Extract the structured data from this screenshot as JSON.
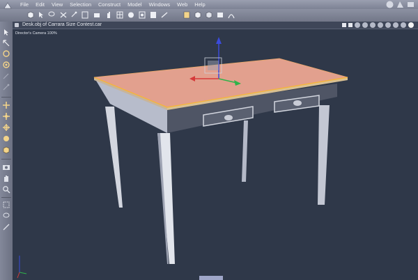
{
  "menu": [
    "File",
    "Edit",
    "View",
    "Selection",
    "Construct",
    "Model",
    "Windows",
    "Web",
    "Help"
  ],
  "viewport": {
    "title": "Desk.obj of Carrara Size Contest.car",
    "camera_label": "Director's Camera 100%"
  },
  "icons": {
    "toolbar": [
      "cube-icon",
      "arrow-icon",
      "lasso-icon",
      "scissors-icon",
      "rotate-icon",
      "cube-outline-icon",
      "camera-icon",
      "hand-icon",
      "grid-icon",
      "render-icon",
      "light-icon",
      "pen-icon",
      "box-icon",
      "box-icon-2",
      "morph-icon",
      "shader-icon"
    ],
    "leftbar": [
      "select-arrow-icon",
      "move-icon",
      "rotate-icon",
      "scale-icon",
      "pen-tool-icon",
      "magic-wand-icon",
      "move-planar-icon",
      "move-3d-icon",
      "rotate-3d-icon",
      "scale-3d-icon",
      "box-tool-icon",
      "camera-icon",
      "hand-icon",
      "zoom-icon",
      "rect-select-icon",
      "lasso-icon",
      "knife-icon"
    ]
  },
  "colors": {
    "viewport_bg": "#2f3849",
    "table_top": "#e2a08e",
    "table_edge": "#f6b43a",
    "wood": "#c8ccd8"
  }
}
